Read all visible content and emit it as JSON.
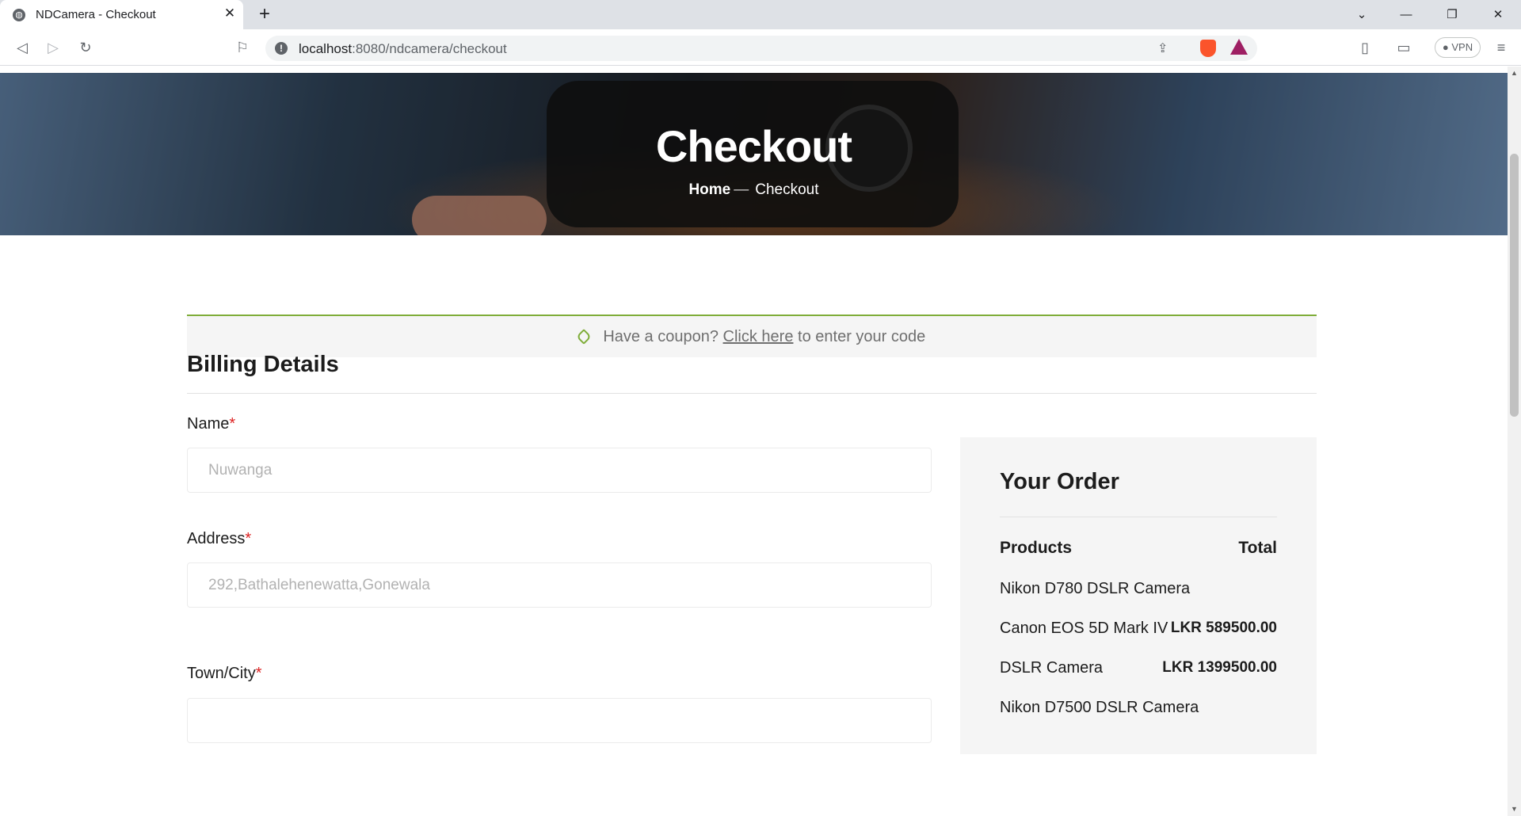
{
  "browser": {
    "tab_title": "NDCamera - Checkout",
    "url_host": "localhost",
    "url_path": ":8080/ndcamera/checkout",
    "vpn_label": "VPN"
  },
  "hero": {
    "title": "Checkout",
    "breadcrumb_home": "Home",
    "breadcrumb_separator": "—",
    "breadcrumb_current": "Checkout"
  },
  "coupon": {
    "prefix": "Have a coupon?",
    "link": "Click here",
    "suffix": "to enter your code"
  },
  "billing": {
    "title": "Billing Details",
    "required_mark": "*",
    "fields": [
      {
        "label": "Name",
        "value": "Nuwanga"
      },
      {
        "label": "Address",
        "value": "292,Bathalehenewatta,Gonewala"
      },
      {
        "label": "Town/City",
        "value": ""
      }
    ]
  },
  "order": {
    "title": "Your Order",
    "col_products": "Products",
    "col_total": "Total",
    "items": [
      {
        "name": "Nikon D780 DSLR Camera",
        "price": ""
      },
      {
        "name": "Canon EOS 5D Mark IV",
        "price": "LKR 589500.00"
      },
      {
        "name": "DSLR Camera",
        "price": "LKR 1399500.00"
      },
      {
        "name": "Nikon D7500 DSLR Camera",
        "price": ""
      }
    ]
  },
  "colors": {
    "accent": "#7fad39",
    "required": "#dd2222",
    "panel_bg": "#f5f5f5"
  }
}
